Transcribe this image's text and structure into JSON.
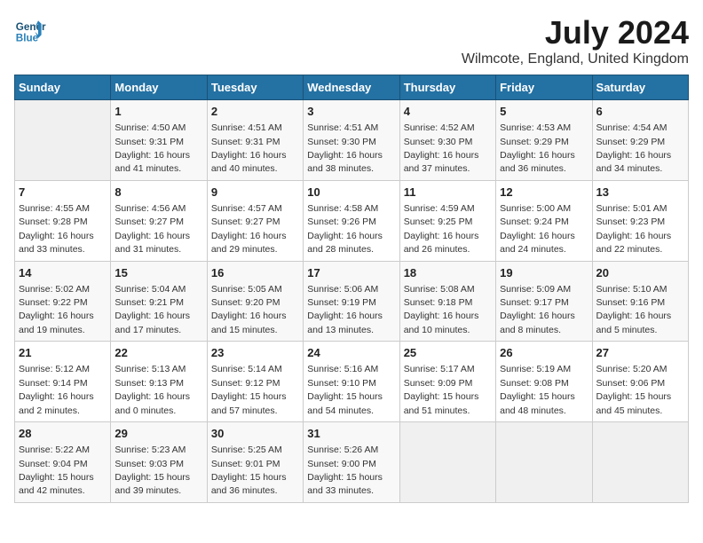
{
  "logo": {
    "line1": "General",
    "line2": "Blue"
  },
  "title": "July 2024",
  "location": "Wilmcote, England, United Kingdom",
  "days_header": [
    "Sunday",
    "Monday",
    "Tuesday",
    "Wednesday",
    "Thursday",
    "Friday",
    "Saturday"
  ],
  "weeks": [
    [
      {
        "day": "",
        "text": ""
      },
      {
        "day": "1",
        "text": "Sunrise: 4:50 AM\nSunset: 9:31 PM\nDaylight: 16 hours\nand 41 minutes."
      },
      {
        "day": "2",
        "text": "Sunrise: 4:51 AM\nSunset: 9:31 PM\nDaylight: 16 hours\nand 40 minutes."
      },
      {
        "day": "3",
        "text": "Sunrise: 4:51 AM\nSunset: 9:30 PM\nDaylight: 16 hours\nand 38 minutes."
      },
      {
        "day": "4",
        "text": "Sunrise: 4:52 AM\nSunset: 9:30 PM\nDaylight: 16 hours\nand 37 minutes."
      },
      {
        "day": "5",
        "text": "Sunrise: 4:53 AM\nSunset: 9:29 PM\nDaylight: 16 hours\nand 36 minutes."
      },
      {
        "day": "6",
        "text": "Sunrise: 4:54 AM\nSunset: 9:29 PM\nDaylight: 16 hours\nand 34 minutes."
      }
    ],
    [
      {
        "day": "7",
        "text": "Sunrise: 4:55 AM\nSunset: 9:28 PM\nDaylight: 16 hours\nand 33 minutes."
      },
      {
        "day": "8",
        "text": "Sunrise: 4:56 AM\nSunset: 9:27 PM\nDaylight: 16 hours\nand 31 minutes."
      },
      {
        "day": "9",
        "text": "Sunrise: 4:57 AM\nSunset: 9:27 PM\nDaylight: 16 hours\nand 29 minutes."
      },
      {
        "day": "10",
        "text": "Sunrise: 4:58 AM\nSunset: 9:26 PM\nDaylight: 16 hours\nand 28 minutes."
      },
      {
        "day": "11",
        "text": "Sunrise: 4:59 AM\nSunset: 9:25 PM\nDaylight: 16 hours\nand 26 minutes."
      },
      {
        "day": "12",
        "text": "Sunrise: 5:00 AM\nSunset: 9:24 PM\nDaylight: 16 hours\nand 24 minutes."
      },
      {
        "day": "13",
        "text": "Sunrise: 5:01 AM\nSunset: 9:23 PM\nDaylight: 16 hours\nand 22 minutes."
      }
    ],
    [
      {
        "day": "14",
        "text": "Sunrise: 5:02 AM\nSunset: 9:22 PM\nDaylight: 16 hours\nand 19 minutes."
      },
      {
        "day": "15",
        "text": "Sunrise: 5:04 AM\nSunset: 9:21 PM\nDaylight: 16 hours\nand 17 minutes."
      },
      {
        "day": "16",
        "text": "Sunrise: 5:05 AM\nSunset: 9:20 PM\nDaylight: 16 hours\nand 15 minutes."
      },
      {
        "day": "17",
        "text": "Sunrise: 5:06 AM\nSunset: 9:19 PM\nDaylight: 16 hours\nand 13 minutes."
      },
      {
        "day": "18",
        "text": "Sunrise: 5:08 AM\nSunset: 9:18 PM\nDaylight: 16 hours\nand 10 minutes."
      },
      {
        "day": "19",
        "text": "Sunrise: 5:09 AM\nSunset: 9:17 PM\nDaylight: 16 hours\nand 8 minutes."
      },
      {
        "day": "20",
        "text": "Sunrise: 5:10 AM\nSunset: 9:16 PM\nDaylight: 16 hours\nand 5 minutes."
      }
    ],
    [
      {
        "day": "21",
        "text": "Sunrise: 5:12 AM\nSunset: 9:14 PM\nDaylight: 16 hours\nand 2 minutes."
      },
      {
        "day": "22",
        "text": "Sunrise: 5:13 AM\nSunset: 9:13 PM\nDaylight: 16 hours\nand 0 minutes."
      },
      {
        "day": "23",
        "text": "Sunrise: 5:14 AM\nSunset: 9:12 PM\nDaylight: 15 hours\nand 57 minutes."
      },
      {
        "day": "24",
        "text": "Sunrise: 5:16 AM\nSunset: 9:10 PM\nDaylight: 15 hours\nand 54 minutes."
      },
      {
        "day": "25",
        "text": "Sunrise: 5:17 AM\nSunset: 9:09 PM\nDaylight: 15 hours\nand 51 minutes."
      },
      {
        "day": "26",
        "text": "Sunrise: 5:19 AM\nSunset: 9:08 PM\nDaylight: 15 hours\nand 48 minutes."
      },
      {
        "day": "27",
        "text": "Sunrise: 5:20 AM\nSunset: 9:06 PM\nDaylight: 15 hours\nand 45 minutes."
      }
    ],
    [
      {
        "day": "28",
        "text": "Sunrise: 5:22 AM\nSunset: 9:04 PM\nDaylight: 15 hours\nand 42 minutes."
      },
      {
        "day": "29",
        "text": "Sunrise: 5:23 AM\nSunset: 9:03 PM\nDaylight: 15 hours\nand 39 minutes."
      },
      {
        "day": "30",
        "text": "Sunrise: 5:25 AM\nSunset: 9:01 PM\nDaylight: 15 hours\nand 36 minutes."
      },
      {
        "day": "31",
        "text": "Sunrise: 5:26 AM\nSunset: 9:00 PM\nDaylight: 15 hours\nand 33 minutes."
      },
      {
        "day": "",
        "text": ""
      },
      {
        "day": "",
        "text": ""
      },
      {
        "day": "",
        "text": ""
      }
    ]
  ]
}
